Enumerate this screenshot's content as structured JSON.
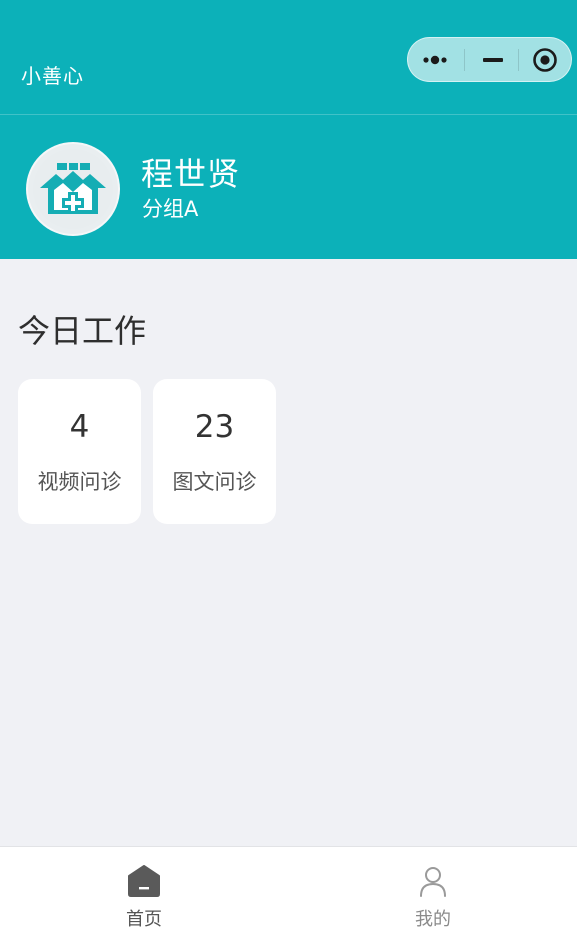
{
  "navbar": {
    "title": "小善心",
    "capsule": {
      "more_icon": "more-dots-icon",
      "minimize_icon": "minimize-icon",
      "close_icon": "close-circle-icon"
    }
  },
  "profile": {
    "avatar_icon": "hospital-icon",
    "name": "程世贤",
    "group": "分组A"
  },
  "today": {
    "title": "今日工作",
    "cards": [
      {
        "count": "4",
        "label": "视频问诊"
      },
      {
        "count": "23",
        "label": "图文问诊"
      }
    ]
  },
  "tabbar": {
    "items": [
      {
        "label": "首页",
        "icon": "home-icon",
        "active": true
      },
      {
        "label": "我的",
        "icon": "user-icon",
        "active": false
      }
    ]
  },
  "colors": {
    "brand": "#0cb1b9",
    "background": "#f0f1f5",
    "card": "#ffffff",
    "text_dark": "#333333"
  }
}
